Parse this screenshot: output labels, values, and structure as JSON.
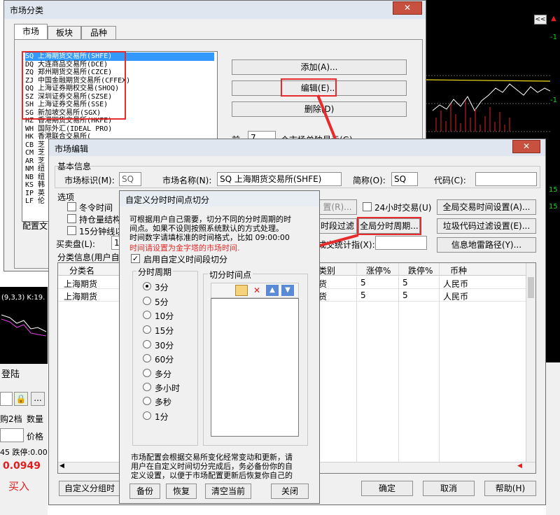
{
  "market_classify": {
    "title": "市场分类",
    "tabs": [
      "市场",
      "板块",
      "品种"
    ],
    "markets": [
      "SQ 上海期货交易所(SHFE)",
      "DQ 大连商品交易所(DCE)",
      "ZQ 郑州期货交易所(CZCE)",
      "ZJ 中国金融期货交易所(CFFEX)",
      "QQ 上海证券期权交易(SHOQ)",
      "SZ 深圳证券交易所(SZSE)",
      "SH 上海证券交易所(SSE)",
      "SG 新加坡交易所(SGX)",
      "HZ 香港期货交易所(HKFE)",
      "WH 国际外汇(IDEAL PRO)",
      "HK 香港联合交易所(",
      "CB 芝",
      "CM 芝",
      "AR 芝",
      "NM 纽",
      "NB 纽",
      "KS 韩",
      "IP 英",
      "LF 伦"
    ],
    "add_button": "添加(A)...",
    "edit_button": "编辑(E)...",
    "delete_button": "删除(D)",
    "single_display_prefix": "前",
    "single_display_value": "7",
    "single_display_suffix": "个市场单独显示(G)",
    "config_label": "配置文"
  },
  "market_edit": {
    "title": "市场编辑",
    "basic_info": "基本信息",
    "market_id_label": "市场标识(M):",
    "market_id_value": "SQ",
    "market_name_label": "市场名称(N):",
    "market_name_value": "SQ 上海期货交易所(SHFE)",
    "short_name_label": "简称(O):",
    "short_name_value": "SQ",
    "code_label": "代码(C):",
    "code_value": "",
    "options_label": "选项",
    "option1": "冬令时间",
    "option2": "持仓量结构",
    "option3": "15分钟线以",
    "buy_sell_label": "买卖盘(L):",
    "buy_sell_value": "1",
    "btn_r": "置(R)...",
    "hours24_label": "24小时交易(U)",
    "global_trade_time_button": "全局交易时间设置(A)...",
    "time_filter_button": "时段过滤",
    "global_period_button": "全局分时周期...",
    "junk_code_filter_button": "垃圾代码过滤设置(E)...",
    "index_label": "成交统计指(X):",
    "index_value": "",
    "info_mine_button": "信息地雷路径(Y)...",
    "category_info_label": "分类信息(用户自",
    "table_headers": [
      "分类名",
      "类别",
      "涨停%",
      "跌停%",
      "币种"
    ],
    "table_rows": [
      [
        "上海期货",
        "货",
        "5",
        "5",
        "人民币"
      ],
      [
        "上海期货",
        "货",
        "5",
        "5",
        "人民币"
      ]
    ],
    "custom_button": "自定义分组时",
    "ok_button": "确定",
    "cancel_button": "取消",
    "help_button": "帮助(H)"
  },
  "custom_time": {
    "title": "自定义分时时间点切分",
    "desc_line1": "可根据用户自己需要，切分不同的分时周期的时",
    "desc_line2": "间点。如果不设则按照系统默认的方式处理。",
    "desc_line3": "时间数字请填标准的时间格式，比如 09:00:00",
    "desc_red": "时间请设置为金字塔的市场时间.",
    "enable_label": "启用自定义时间段切分",
    "period_group": "分时周期",
    "periods": [
      "3分",
      "5分",
      "10分",
      "15分",
      "30分",
      "60分",
      "多分",
      "多小时",
      "多秒",
      "1分"
    ],
    "selected_period": "3分",
    "cut_group": "切分时间点",
    "note_line1": "市场配置会根据交易所变化经常变动和更新，请",
    "note_line2": "用户在自定义时间切分完成后，务必备份你的自",
    "note_line3": "定义设置，以便于市场配置更新后恢复你自己的",
    "backup_button": "备份",
    "restore_button": "恢复",
    "clear_button": "清空当前",
    "close_button": "关闭"
  },
  "background": {
    "indicator_text": "(9,3,3)  K:19.",
    "login_title": "登陆",
    "stall_label": "购2档",
    "qty_label": "数量",
    "price_label": "价格",
    "limit_text": "45  跌停:0.00",
    "price_value": "0.0949",
    "buy_button": "买入",
    "scroll_left": "<<",
    "axis_labels": [
      "-1",
      "-1",
      "15",
      "15"
    ]
  },
  "colors": {
    "annotation_red": "#e52b2b",
    "chart_bg": "#000000",
    "selection_blue": "#3399ff"
  }
}
